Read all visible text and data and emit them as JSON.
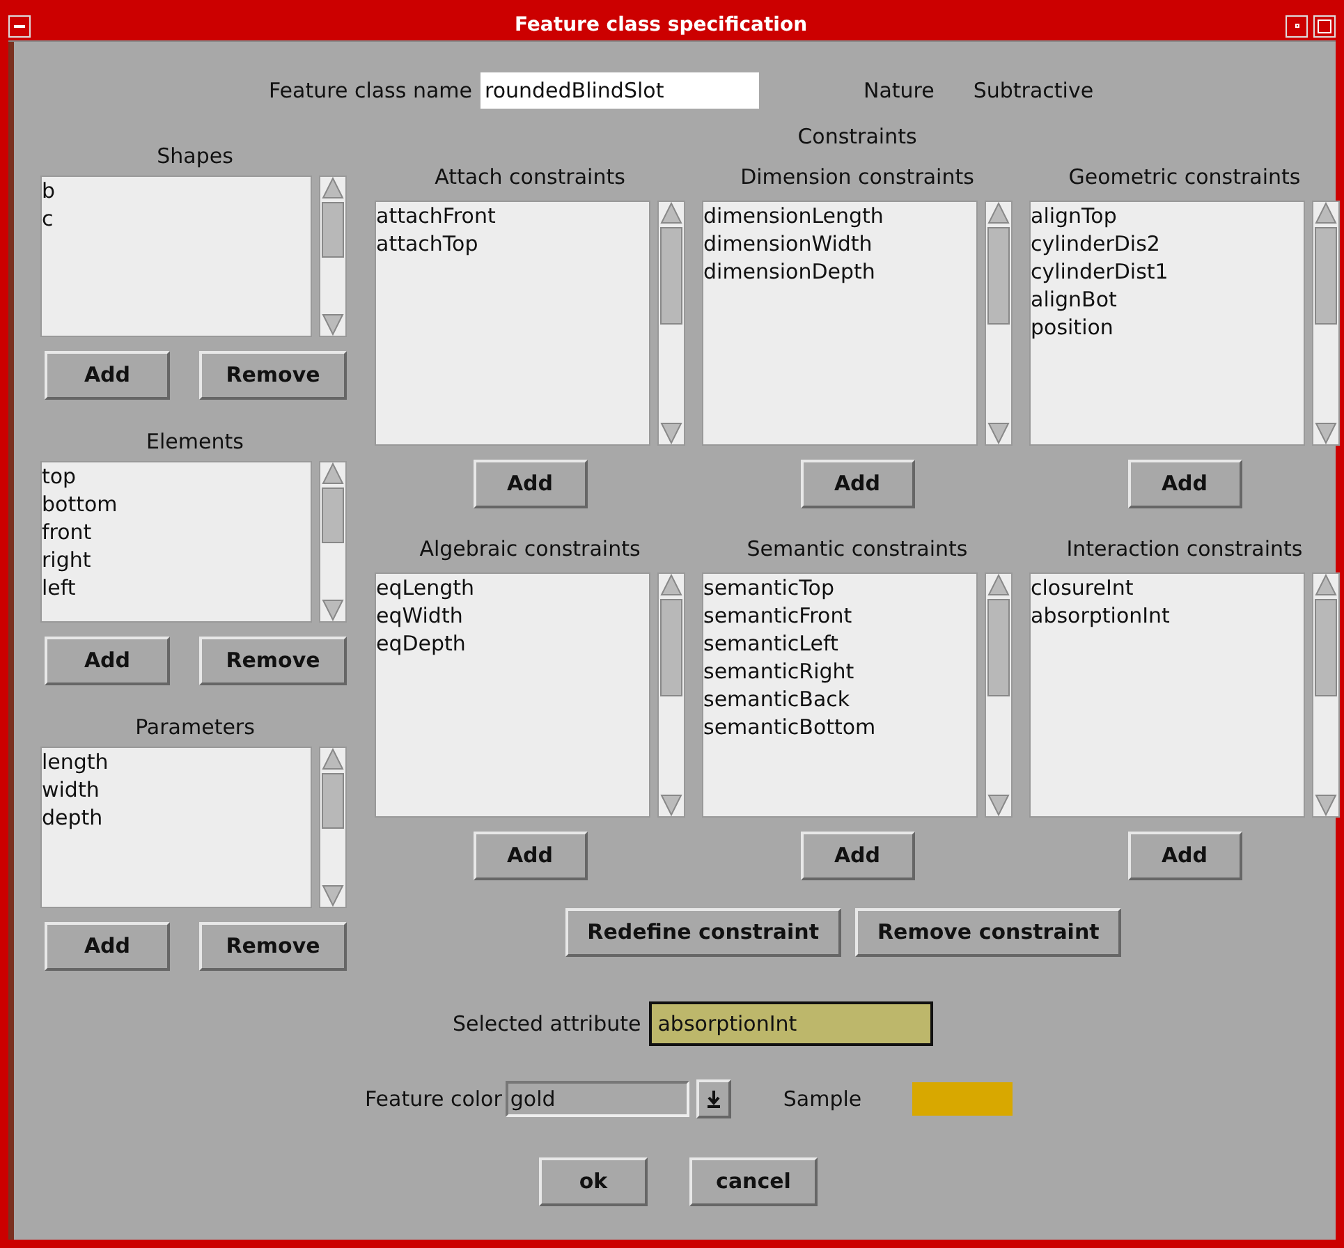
{
  "window": {
    "title": "Feature class specification"
  },
  "feature_class_name": {
    "label": "Feature class name",
    "value": "roundedBlindSlot"
  },
  "nature": {
    "label": "Nature",
    "value": "Subtractive"
  },
  "left_lists": [
    {
      "title": "Shapes",
      "items": [
        "b",
        "c"
      ],
      "buttons": [
        "Add",
        "Remove"
      ]
    },
    {
      "title": "Elements",
      "items": [
        "top",
        "bottom",
        "front",
        "right",
        "left"
      ],
      "buttons": [
        "Add",
        "Remove"
      ]
    },
    {
      "title": "Parameters",
      "items": [
        "length",
        "width",
        "depth"
      ],
      "buttons": [
        "Add",
        "Remove"
      ]
    }
  ],
  "constraints": {
    "title": "Constraints",
    "groups": [
      {
        "title": "Attach constraints",
        "items": [
          "attachFront",
          "attachTop"
        ],
        "button": "Add"
      },
      {
        "title": "Dimension constraints",
        "items": [
          "dimensionLength",
          "dimensionWidth",
          "dimensionDepth"
        ],
        "button": "Add"
      },
      {
        "title": "Geometric constraints",
        "items": [
          "alignTop",
          "cylinderDis2",
          "cylinderDist1",
          "alignBot",
          "position"
        ],
        "button": "Add"
      },
      {
        "title": "Algebraic constraints",
        "items": [
          "eqLength",
          "eqWidth",
          "eqDepth"
        ],
        "button": "Add"
      },
      {
        "title": "Semantic constraints",
        "items": [
          "semanticTop",
          "semanticFront",
          "semanticLeft",
          "semanticRight",
          "semanticBack",
          "semanticBottom"
        ],
        "button": "Add"
      },
      {
        "title": "Interaction constraints",
        "items": [
          "closureInt",
          "absorptionInt"
        ],
        "button": "Add"
      }
    ]
  },
  "constraint_buttons": [
    "Redefine constraint",
    "Remove constraint"
  ],
  "selected_attribute": {
    "label": "Selected attribute",
    "value": "absorptionInt"
  },
  "feature_color": {
    "label": "Feature color",
    "value": "gold",
    "sample_label": "Sample",
    "color": "#d8a800"
  },
  "buttons": [
    "ok",
    "cancel"
  ]
}
